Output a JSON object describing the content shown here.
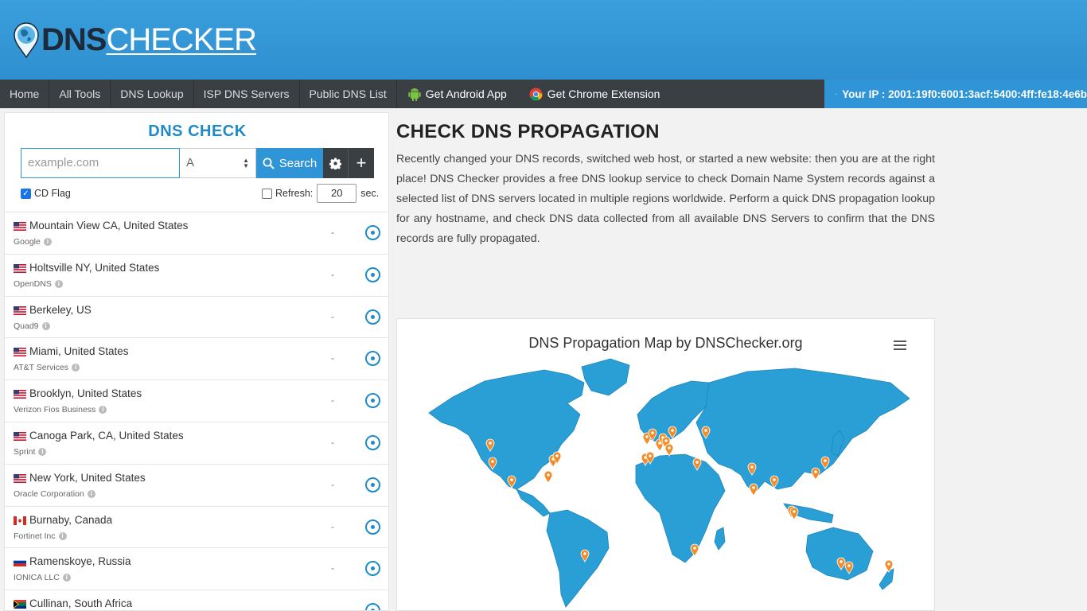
{
  "header": {
    "logo_dns": "DNS",
    "logo_checker": "CHECKER"
  },
  "nav": {
    "items": [
      "Home",
      "All Tools",
      "DNS Lookup",
      "ISP DNS Servers",
      "Public DNS List"
    ],
    "android": "Get Android App",
    "chrome": "Get Chrome Extension",
    "ip": "Your IP : 2001:19f0:6001:3acf:5400:4ff:fe18:4e6b"
  },
  "check": {
    "title": "DNS CHECK",
    "placeholder": "example.com",
    "type": "A",
    "search_label": "Search",
    "cd_flag": "CD Flag",
    "refresh_label": "Refresh:",
    "refresh_value": "20",
    "refresh_unit": "sec."
  },
  "servers": [
    {
      "location": "Mountain View CA, United States",
      "provider": "Google",
      "flag": "us",
      "result": "-"
    },
    {
      "location": "Holtsville NY, United States",
      "provider": "OpenDNS",
      "flag": "us",
      "result": "-"
    },
    {
      "location": "Berkeley, US",
      "provider": "Quad9",
      "flag": "us",
      "result": "-"
    },
    {
      "location": "Miami, United States",
      "provider": "AT&T Services",
      "flag": "us",
      "result": "-"
    },
    {
      "location": "Brooklyn, United States",
      "provider": "Verizon Fios Business",
      "flag": "us",
      "result": "-"
    },
    {
      "location": "Canoga Park, CA, United States",
      "provider": "Sprint",
      "flag": "us",
      "result": "-"
    },
    {
      "location": "New York, United States",
      "provider": "Oracle Corporation",
      "flag": "us",
      "result": "-"
    },
    {
      "location": "Burnaby, Canada",
      "provider": "Fortinet Inc",
      "flag": "ca",
      "result": "-"
    },
    {
      "location": "Ramenskoye, Russia",
      "provider": "IONICA LLC",
      "flag": "ru",
      "result": "-"
    },
    {
      "location": "Cullinan, South Africa",
      "provider": "",
      "flag": "za",
      "result": ""
    }
  ],
  "main": {
    "title": "CHECK DNS PROPAGATION",
    "description": "Recently changed your DNS records, switched web host, or started a new website: then you are at the right place! DNS Checker provides a free DNS lookup service to check Domain Name System records against a selected list of DNS servers located in multiple regions worldwide. Perform a quick DNS propagation lookup for any hostname, and check DNS data collected from all available DNS Servers to confirm that the DNS records are fully propagated."
  },
  "map": {
    "title": "DNS Propagation Map by DNSChecker.org",
    "land_color": "#2a9fd6",
    "marker_color": "#f28c28"
  }
}
